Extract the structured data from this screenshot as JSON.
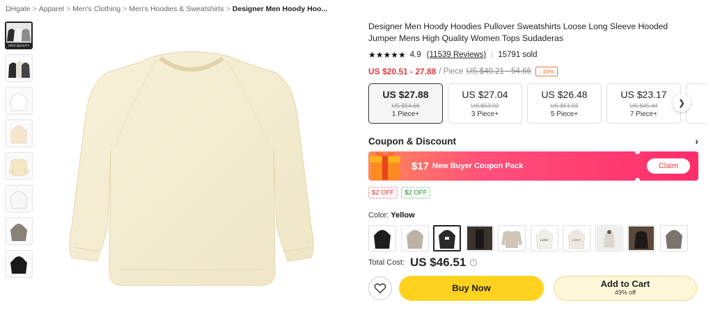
{
  "breadcrumb": {
    "items": [
      "DHgate",
      "Apparel",
      "Men's Clothing",
      "Men's Hoodies & Sweatshirts"
    ],
    "current": "Designer Men Hoody Hoo..."
  },
  "thumbnails": {
    "first_badge": "HIGH QUALITY",
    "colors": [
      "#2b2b2b",
      "#4a4a4a",
      "#ffffff",
      "#f6e6cf",
      "#f3e7c6",
      "#f2f2f2",
      "#8a8278",
      "#1a1a1a"
    ]
  },
  "product": {
    "title": "Designer Men Hoody Hoodies Pullover Sweatshirts Loose Long Sleeve Hooded Jumper Mens High Quality Women Tops Sudaderas",
    "stars": "★★★★★",
    "rating": "4.9",
    "reviews": "(11539 Reviews)",
    "sold": "15791 sold",
    "price_range": "US $20.51 - 27.88",
    "per_piece": "/ Piece",
    "old_range": "US $40.21 - 54.66",
    "discount": "↓ 49%",
    "main_color": "#f4edd2"
  },
  "tiers": [
    {
      "price": "US $27.88",
      "old": "US $54.66",
      "qty": "1 Piece+"
    },
    {
      "price": "US $27.04",
      "old": "US $53.02",
      "qty": "3 Piece+"
    },
    {
      "price": "US $26.48",
      "old": "US $51.93",
      "qty": "5 Piece+"
    },
    {
      "price": "US $23.17",
      "old": "US $45.44",
      "qty": "7 Piece+"
    }
  ],
  "coupon": {
    "title": "Coupon & Discount",
    "amount": "$17",
    "text": "New Buyer Coupon Pack",
    "claim": "Claim",
    "chips": [
      "$2 OFF",
      "$2 OFF"
    ]
  },
  "color": {
    "label": "Color: ",
    "value": "Yellow",
    "swatches": [
      "#1e1e1e",
      "#bdb2a3",
      "#2a2a2a",
      "#2b2621",
      "#cfc6b8",
      "#f1efe9",
      "#ece9e2",
      "#d9d6cf",
      "#3a2f26",
      "#7a746c"
    ],
    "swatch_text": "Letter"
  },
  "total": {
    "label": "Total Cost:",
    "price": "US $46.51",
    "info": "i"
  },
  "actions": {
    "buy_now": "Buy Now",
    "add_to_cart": "Add to Cart",
    "cart_sub": "49% off"
  }
}
